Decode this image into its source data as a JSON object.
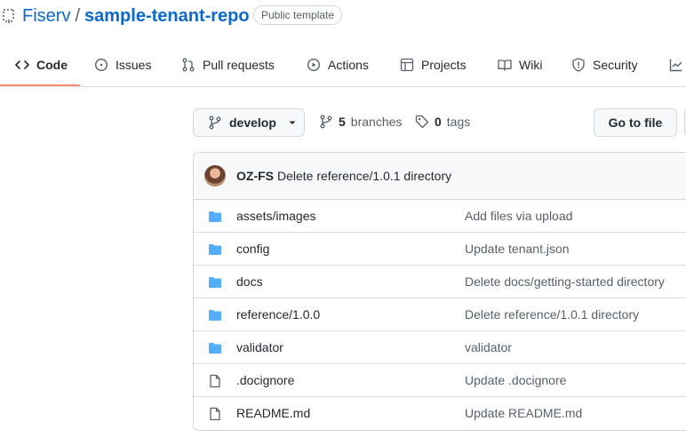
{
  "repo": {
    "owner": "Fiserv",
    "separator": "/",
    "name": "sample-tenant-repo",
    "badge": "Public template"
  },
  "tabs": [
    {
      "label": "Code",
      "icon": "code-icon",
      "selected": true
    },
    {
      "label": "Issues",
      "icon": "issue-icon"
    },
    {
      "label": "Pull requests",
      "icon": "pull-request-icon"
    },
    {
      "label": "Actions",
      "icon": "play-icon"
    },
    {
      "label": "Projects",
      "icon": "table-icon"
    },
    {
      "label": "Wiki",
      "icon": "book-icon"
    },
    {
      "label": "Security",
      "icon": "shield-icon"
    }
  ],
  "toolbar": {
    "branch": "develop",
    "branches_count": "5",
    "branches_label": "branches",
    "tags_count": "0",
    "tags_label": "tags",
    "goto_file": "Go to file"
  },
  "latest_commit": {
    "author": "OZ-FS",
    "message": "Delete reference/1.0.1 directory"
  },
  "files": [
    {
      "type": "dir",
      "name": "assets/images",
      "message": "Add files via upload"
    },
    {
      "type": "dir",
      "name": "config",
      "message": "Update tenant.json"
    },
    {
      "type": "dir",
      "name": "docs",
      "message": "Delete docs/getting-started directory"
    },
    {
      "type": "dir",
      "name": "reference/1.0.0",
      "message": "Delete reference/1.0.1 directory"
    },
    {
      "type": "dir",
      "name": "validator",
      "message": "validator"
    },
    {
      "type": "file",
      "name": ".docignore",
      "message": "Update .docignore"
    },
    {
      "type": "file",
      "name": "README.md",
      "message": "Update README.md"
    }
  ],
  "colors": {
    "link": "#0969da",
    "folder": "#54aeff",
    "tab_underline": "#fd8c73"
  }
}
